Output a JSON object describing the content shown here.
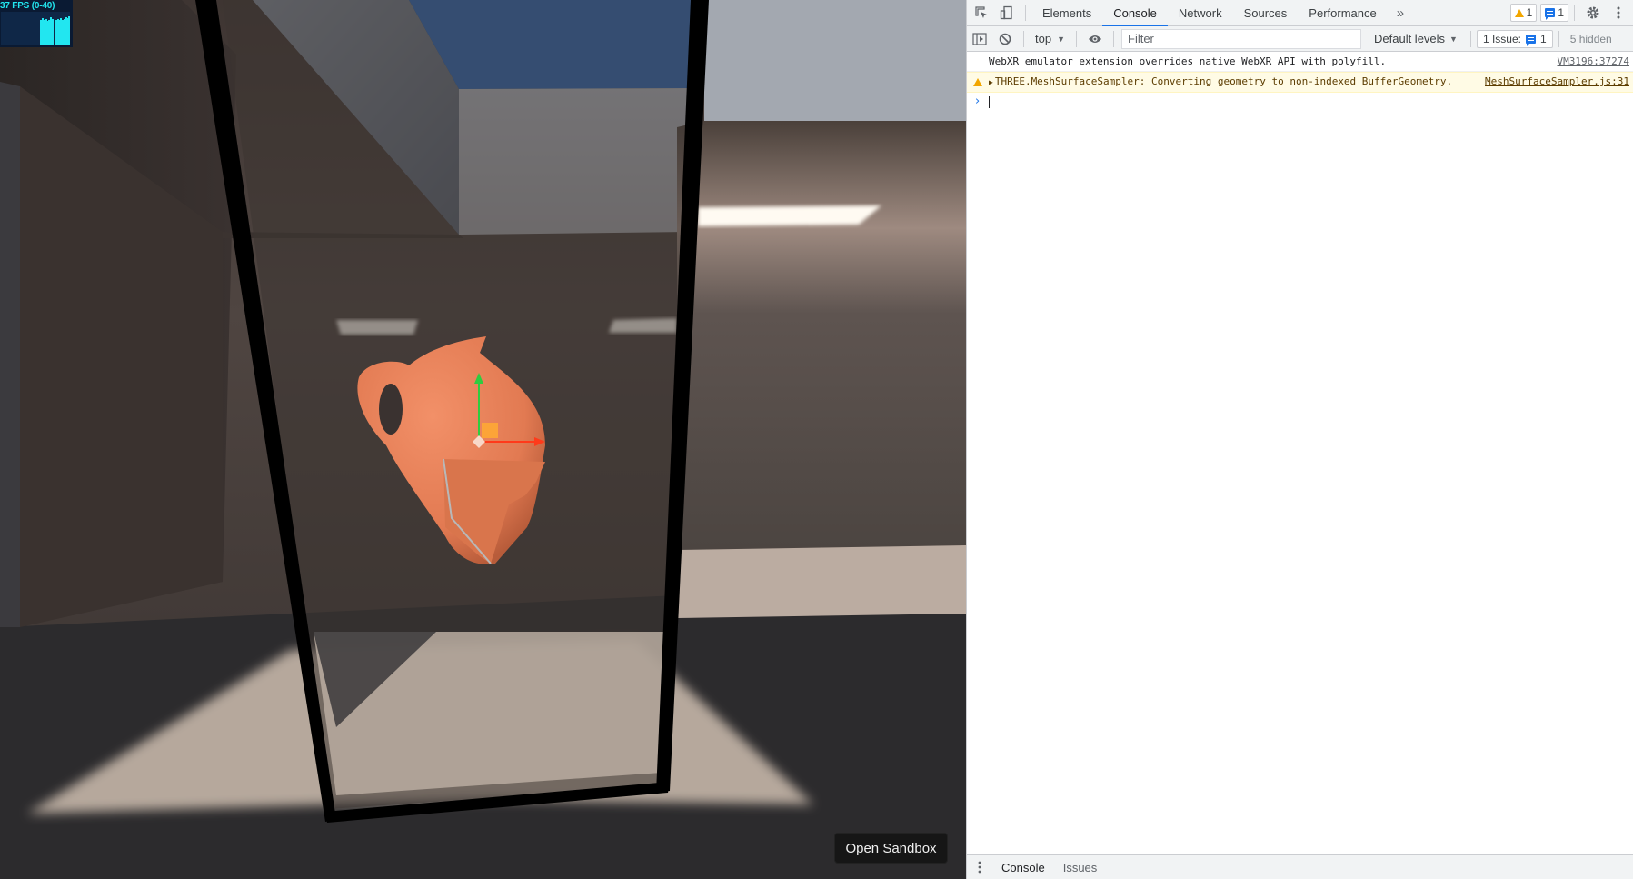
{
  "viewport": {
    "fps_label": "37 FPS (0-40)",
    "fps_history": [
      0,
      0,
      0,
      0,
      0,
      0,
      0,
      0,
      0,
      0,
      0,
      0,
      0,
      0,
      0,
      0,
      0,
      0,
      0,
      0,
      0,
      0,
      0,
      0,
      30,
      32,
      30,
      31,
      29,
      30,
      33,
      31,
      0,
      30,
      31,
      30,
      32,
      30,
      31,
      33,
      32,
      34
    ],
    "fps_range": [
      0,
      40
    ],
    "open_sandbox_label": "Open Sandbox",
    "colors": {
      "sky": "#2d6cbf",
      "pitcher": "#e8845c",
      "gizmo_y": "#2ecc40",
      "gizmo_x": "#ff3a1a",
      "gizmo_plane": "#ffaa33",
      "floor_light": "#bcaea3",
      "floor_dark": "#2c2c2e",
      "wall": "#4d4440",
      "frame": "#000000"
    }
  },
  "devtools": {
    "tabs": [
      {
        "label": "Elements",
        "active": false
      },
      {
        "label": "Console",
        "active": true
      },
      {
        "label": "Network",
        "active": false
      },
      {
        "label": "Sources",
        "active": false
      },
      {
        "label": "Performance",
        "active": false
      }
    ],
    "more_tabs_icon": "»",
    "warning_count": "1",
    "message_count": "1",
    "toolbar": {
      "context": "top",
      "filter_placeholder": "Filter",
      "levels": "Default levels",
      "issues_label": "1 Issue:",
      "issues_count": "1",
      "hidden": "5 hidden"
    },
    "console": [
      {
        "level": "info",
        "text": "WebXR emulator extension overrides native WebXR API with polyfill.",
        "source": "VM3196:37274"
      },
      {
        "level": "warning",
        "text": "THREE.MeshSurfaceSampler: Converting geometry to non-indexed BufferGeometry.",
        "source": "MeshSurfaceSampler.js:31"
      }
    ],
    "prompt_symbol": "›",
    "drawer": {
      "tabs": [
        {
          "label": "Console",
          "active": true
        },
        {
          "label": "Issues",
          "active": false
        }
      ]
    }
  }
}
